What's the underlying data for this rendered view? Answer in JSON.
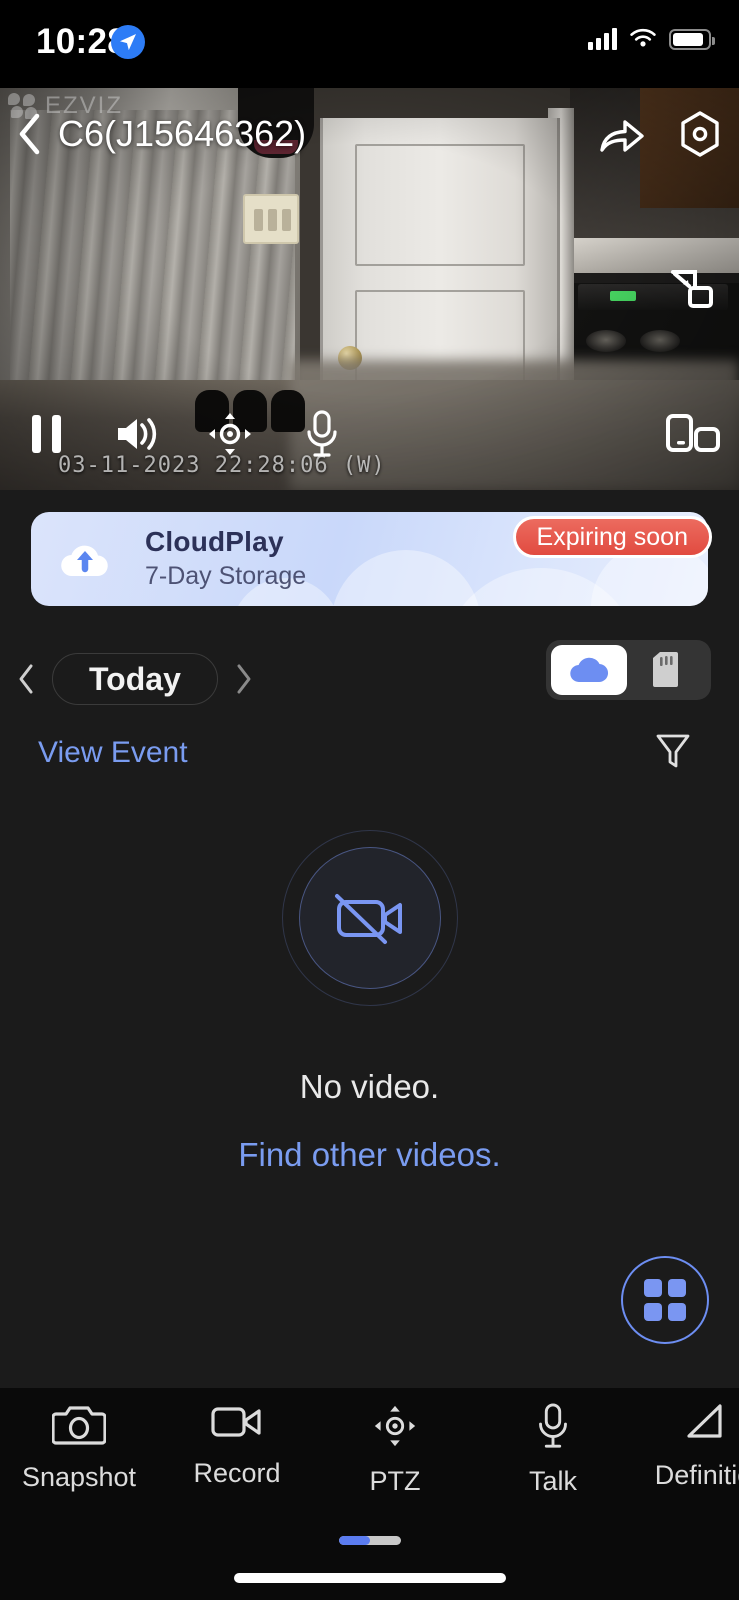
{
  "statusbar": {
    "time": "10:28",
    "location_icon": "location-arrow-icon",
    "cellular_icon": "cellular-bars-icon",
    "wifi_icon": "wifi-icon",
    "battery_icon": "battery-icon"
  },
  "video": {
    "watermark": "EZVIZ",
    "title": "C6(J15646362)",
    "back_icon": "back-chevron-icon",
    "share_icon": "share-icon",
    "settings_icon": "settings-hexagon-icon",
    "pip_icon": "picture-in-picture-icon",
    "timestamp": "03-11-2023 22:28:06  (W)",
    "controls": [
      {
        "name": "pause-button",
        "icon": "pause-icon"
      },
      {
        "name": "volume-button",
        "icon": "speaker-on-icon"
      },
      {
        "name": "ptz-button",
        "icon": "ptz-icon"
      },
      {
        "name": "mic-button",
        "icon": "microphone-icon"
      },
      {
        "name": "fullscreen-button",
        "icon": "fullscreen-rotate-icon"
      }
    ]
  },
  "cloud_card": {
    "title": "CloudPlay",
    "subtitle": "7-Day Storage",
    "badge": "Expiring soon",
    "icon": "cloud-upload-icon",
    "badge_color": "#e5544a",
    "title_color": "#2c3158"
  },
  "date_row": {
    "prev_icon": "chevron-left-icon",
    "label": "Today",
    "next_icon": "chevron-right-icon",
    "storage_toggle": [
      {
        "name": "cloud-storage-tab",
        "icon": "cloud-icon",
        "selected": true
      },
      {
        "name": "sdcard-storage-tab",
        "icon": "sd-card-icon",
        "selected": false
      }
    ]
  },
  "event_row": {
    "link": "View Event",
    "link_color": "#7a9cf0",
    "filter_icon": "filter-funnel-icon"
  },
  "empty_state": {
    "icon": "video-camera-off-icon",
    "message": "No video.",
    "action": "Find other videos.",
    "action_color": "#7a9cf0"
  },
  "fab": {
    "icon": "grid-four-squares-icon",
    "accent_color": "#6d8ef2"
  },
  "toolbar": {
    "items": [
      {
        "label": "Snapshot",
        "icon": "camera-icon"
      },
      {
        "label": "Record",
        "icon": "video-camera-icon"
      },
      {
        "label": "PTZ",
        "icon": "ptz-icon"
      },
      {
        "label": "Talk",
        "icon": "microphone-icon"
      },
      {
        "label": "Definition",
        "icon": "definition-quality-icon"
      }
    ]
  },
  "pager": {
    "pages": 2,
    "current": 1
  }
}
